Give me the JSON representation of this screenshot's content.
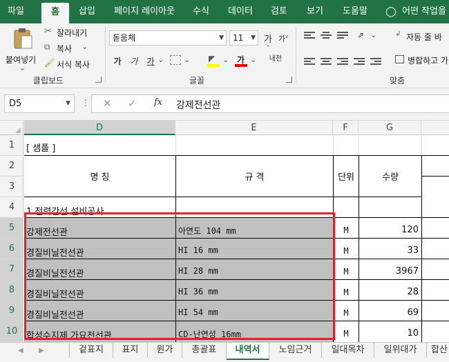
{
  "ribbon_tabs": [
    "파일",
    "홈",
    "삽입",
    "페이지 레이아웃",
    "수식",
    "데이터",
    "검토",
    "보기",
    "도움말",
    "어떤 작업을"
  ],
  "active_tab": "홈",
  "clipboard": {
    "paste": "붙여넣기",
    "cut": "잘라내기",
    "copy": "복사",
    "format_painter": "서식 복사",
    "group_label": "클립보드"
  },
  "font": {
    "name": "돋움체",
    "size": "11",
    "grow": "가",
    "shrink": "가",
    "bold": "가",
    "italic": "가",
    "underline": "가",
    "font_color_glyph": "가",
    "phonetic": "내천",
    "group_label": "글꼴"
  },
  "alignment": {
    "wrap_text": "자동 줄 바",
    "merge": "병합하고 가",
    "group_label": "맞춤"
  },
  "formula_bar": {
    "name_box": "D5",
    "fx": "fx",
    "content": "강제전선관"
  },
  "columns": [
    "D",
    "E",
    "F",
    "G"
  ],
  "rows": [
    "1",
    "2",
    "3",
    "4",
    "5",
    "6",
    "7",
    "8",
    "9",
    "10"
  ],
  "sheet": {
    "r1_title": "[ 샘플 ]",
    "h_name": "명        칭",
    "h_spec": "규        격",
    "h_unit": "단위",
    "h_qty": "수량",
    "r4_section": "1.전력간선 설비공사",
    "items": [
      {
        "name": "강제전선관",
        "spec": "아연도 104 mm",
        "unit": "M",
        "qty": "120"
      },
      {
        "name": "경질비닐전선관",
        "spec": "HI 16 mm",
        "unit": "M",
        "qty": "33"
      },
      {
        "name": "경질비닐전선관",
        "spec": "HI 28 mm",
        "unit": "M",
        "qty": "3967"
      },
      {
        "name": "경질비닐전선관",
        "spec": "HI 36 mm",
        "unit": "M",
        "qty": "28"
      },
      {
        "name": "경질비닐전선관",
        "spec": "HI 54 mm",
        "unit": "M",
        "qty": "69"
      },
      {
        "name": "합성수지제 가요전선관",
        "spec": "CD-난연성 16mm",
        "unit": "M",
        "qty": "10"
      }
    ]
  },
  "sheet_tabs": [
    "겉표지",
    "표지",
    "원가",
    "총괄표",
    "내역서",
    "노임근거",
    "일대목차",
    "일위대가",
    "합산"
  ],
  "active_sheet": "내역서",
  "colors": {
    "excel_green": "#217346",
    "selection_red": "#e0202a",
    "range_gray": "#c0c0c0"
  }
}
